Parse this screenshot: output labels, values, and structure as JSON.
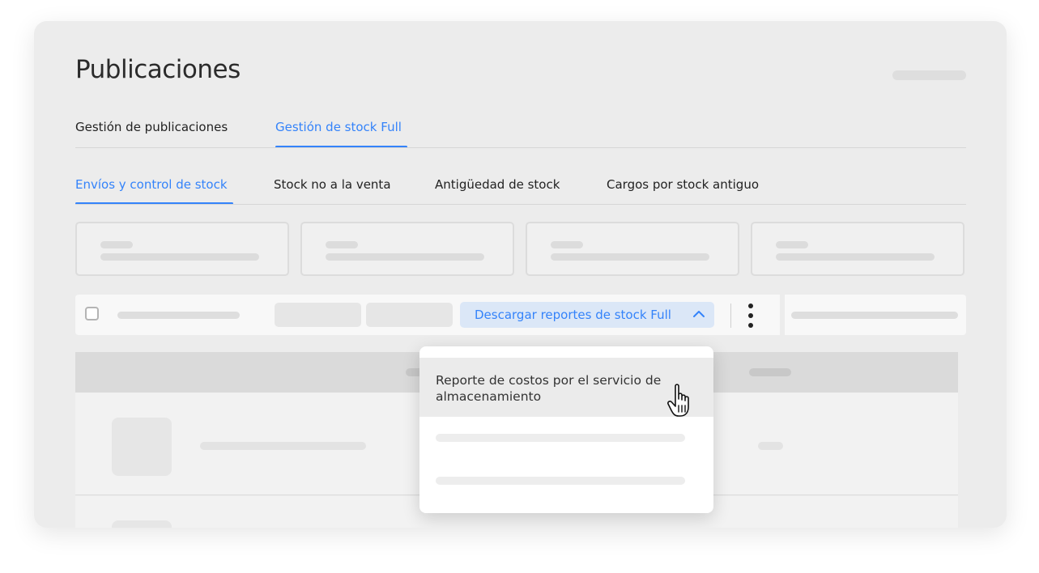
{
  "page": {
    "title": "Publicaciones"
  },
  "tabs": [
    {
      "label": "Gestión de publicaciones",
      "active": false
    },
    {
      "label": "Gestión de stock Full",
      "active": true
    }
  ],
  "subtabs": [
    {
      "label": "Envíos y control de stock",
      "active": true
    },
    {
      "label": "Stock no a la venta",
      "active": false
    },
    {
      "label": "Antigüedad de stock",
      "active": false
    },
    {
      "label": "Cargos por stock antiguo",
      "active": false
    }
  ],
  "toolbar": {
    "download_button_label": "Descargar reportes de stock Full",
    "download_button_icon": "chevron-up-icon",
    "more_icon": "kebab-menu-icon"
  },
  "dropdown": {
    "items": [
      {
        "label": "Reporte de costos por el servicio de almacenamiento",
        "hovered": true
      }
    ]
  },
  "colors": {
    "accent": "#3483fa",
    "background": "#ececec",
    "text": "#222222"
  }
}
